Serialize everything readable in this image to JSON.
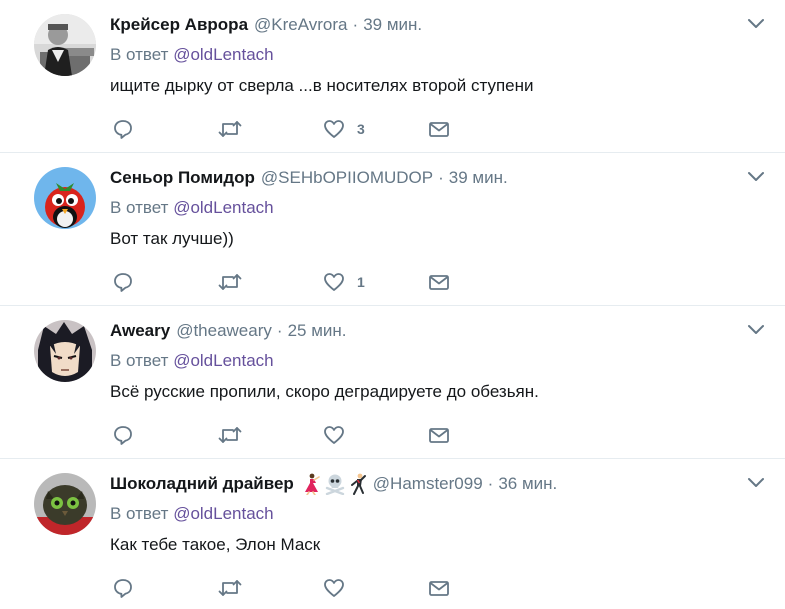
{
  "tweets": [
    {
      "name": "Крейсер Аврора",
      "handle": "@KreAvrora",
      "separator": "·",
      "time": "39 мин.",
      "reply_prefix": "В ответ",
      "reply_mention": "@oldLentach",
      "text": "ищите дырку от сверла ...в носителях второй ступени",
      "likes": "3",
      "avatar_icon": "vintage-photo-avatar"
    },
    {
      "name": "Сеньор Помидор",
      "handle": "@SEHbOPIIOMUDOP",
      "separator": "·",
      "time": "39 мин.",
      "reply_prefix": "В ответ",
      "reply_mention": "@oldLentach",
      "text": "Вот так лучше))",
      "likes": "1",
      "avatar_icon": "cartoon-tomato-avatar"
    },
    {
      "name": "Aweary",
      "handle": "@theaweary",
      "separator": "·",
      "time": "25 мин.",
      "reply_prefix": "В ответ",
      "reply_mention": "@oldLentach",
      "text": "Всё русские пропили, скоро деградируете до обезьян.",
      "likes": "",
      "avatar_icon": "anime-character-avatar"
    },
    {
      "name": "Шоколадний драйвер",
      "handle": "@Hamster099",
      "separator": "·",
      "time": "36 мин.",
      "reply_prefix": "В ответ",
      "reply_mention": "@oldLentach",
      "text": "Как тебе такое, Элон Маск",
      "likes": "",
      "avatar_icon": "owl-avatar",
      "name_emojis": [
        "dancer-emoji",
        "skull-crossbones-emoji",
        "man-dancing-emoji"
      ]
    }
  ],
  "colors": {
    "text": "#14171a",
    "secondary": "#657786",
    "mention": "#66519c",
    "divider": "#e6ecf0"
  }
}
